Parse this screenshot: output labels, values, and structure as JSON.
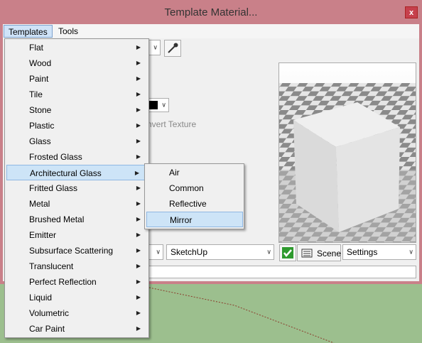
{
  "window": {
    "title": "Template Material...",
    "close_label": "x"
  },
  "menubar": {
    "templates": "Templates",
    "tools": "Tools"
  },
  "templates_menu": {
    "items": [
      {
        "label": "Flat"
      },
      {
        "label": "Wood"
      },
      {
        "label": "Paint"
      },
      {
        "label": "Tile"
      },
      {
        "label": "Stone"
      },
      {
        "label": "Plastic"
      },
      {
        "label": "Glass"
      },
      {
        "label": "Frosted Glass"
      },
      {
        "label": "Architectural Glass"
      },
      {
        "label": "Fritted Glass"
      },
      {
        "label": "Metal"
      },
      {
        "label": "Brushed Metal"
      },
      {
        "label": "Emitter"
      },
      {
        "label": "Subsurface Scattering"
      },
      {
        "label": "Translucent"
      },
      {
        "label": "Perfect Reflection"
      },
      {
        "label": "Liquid"
      },
      {
        "label": "Volumetric"
      },
      {
        "label": "Car Paint"
      }
    ],
    "highlighted": "Architectural Glass"
  },
  "sub_menu": {
    "items": [
      {
        "label": "Air"
      },
      {
        "label": "Common"
      },
      {
        "label": "Reflective"
      },
      {
        "label": "Mirror"
      }
    ],
    "highlighted": "Mirror"
  },
  "panel": {
    "invert_texture_label": "nvert Texture",
    "renderer_select": "SketchUp",
    "scene_button": "Scene",
    "settings_select": "Settings"
  },
  "colors": {
    "title_bar": "#c98089",
    "menu_highlight": "#cde4f7",
    "ground": "#9cbf8e",
    "sky": "#dcdad4"
  }
}
